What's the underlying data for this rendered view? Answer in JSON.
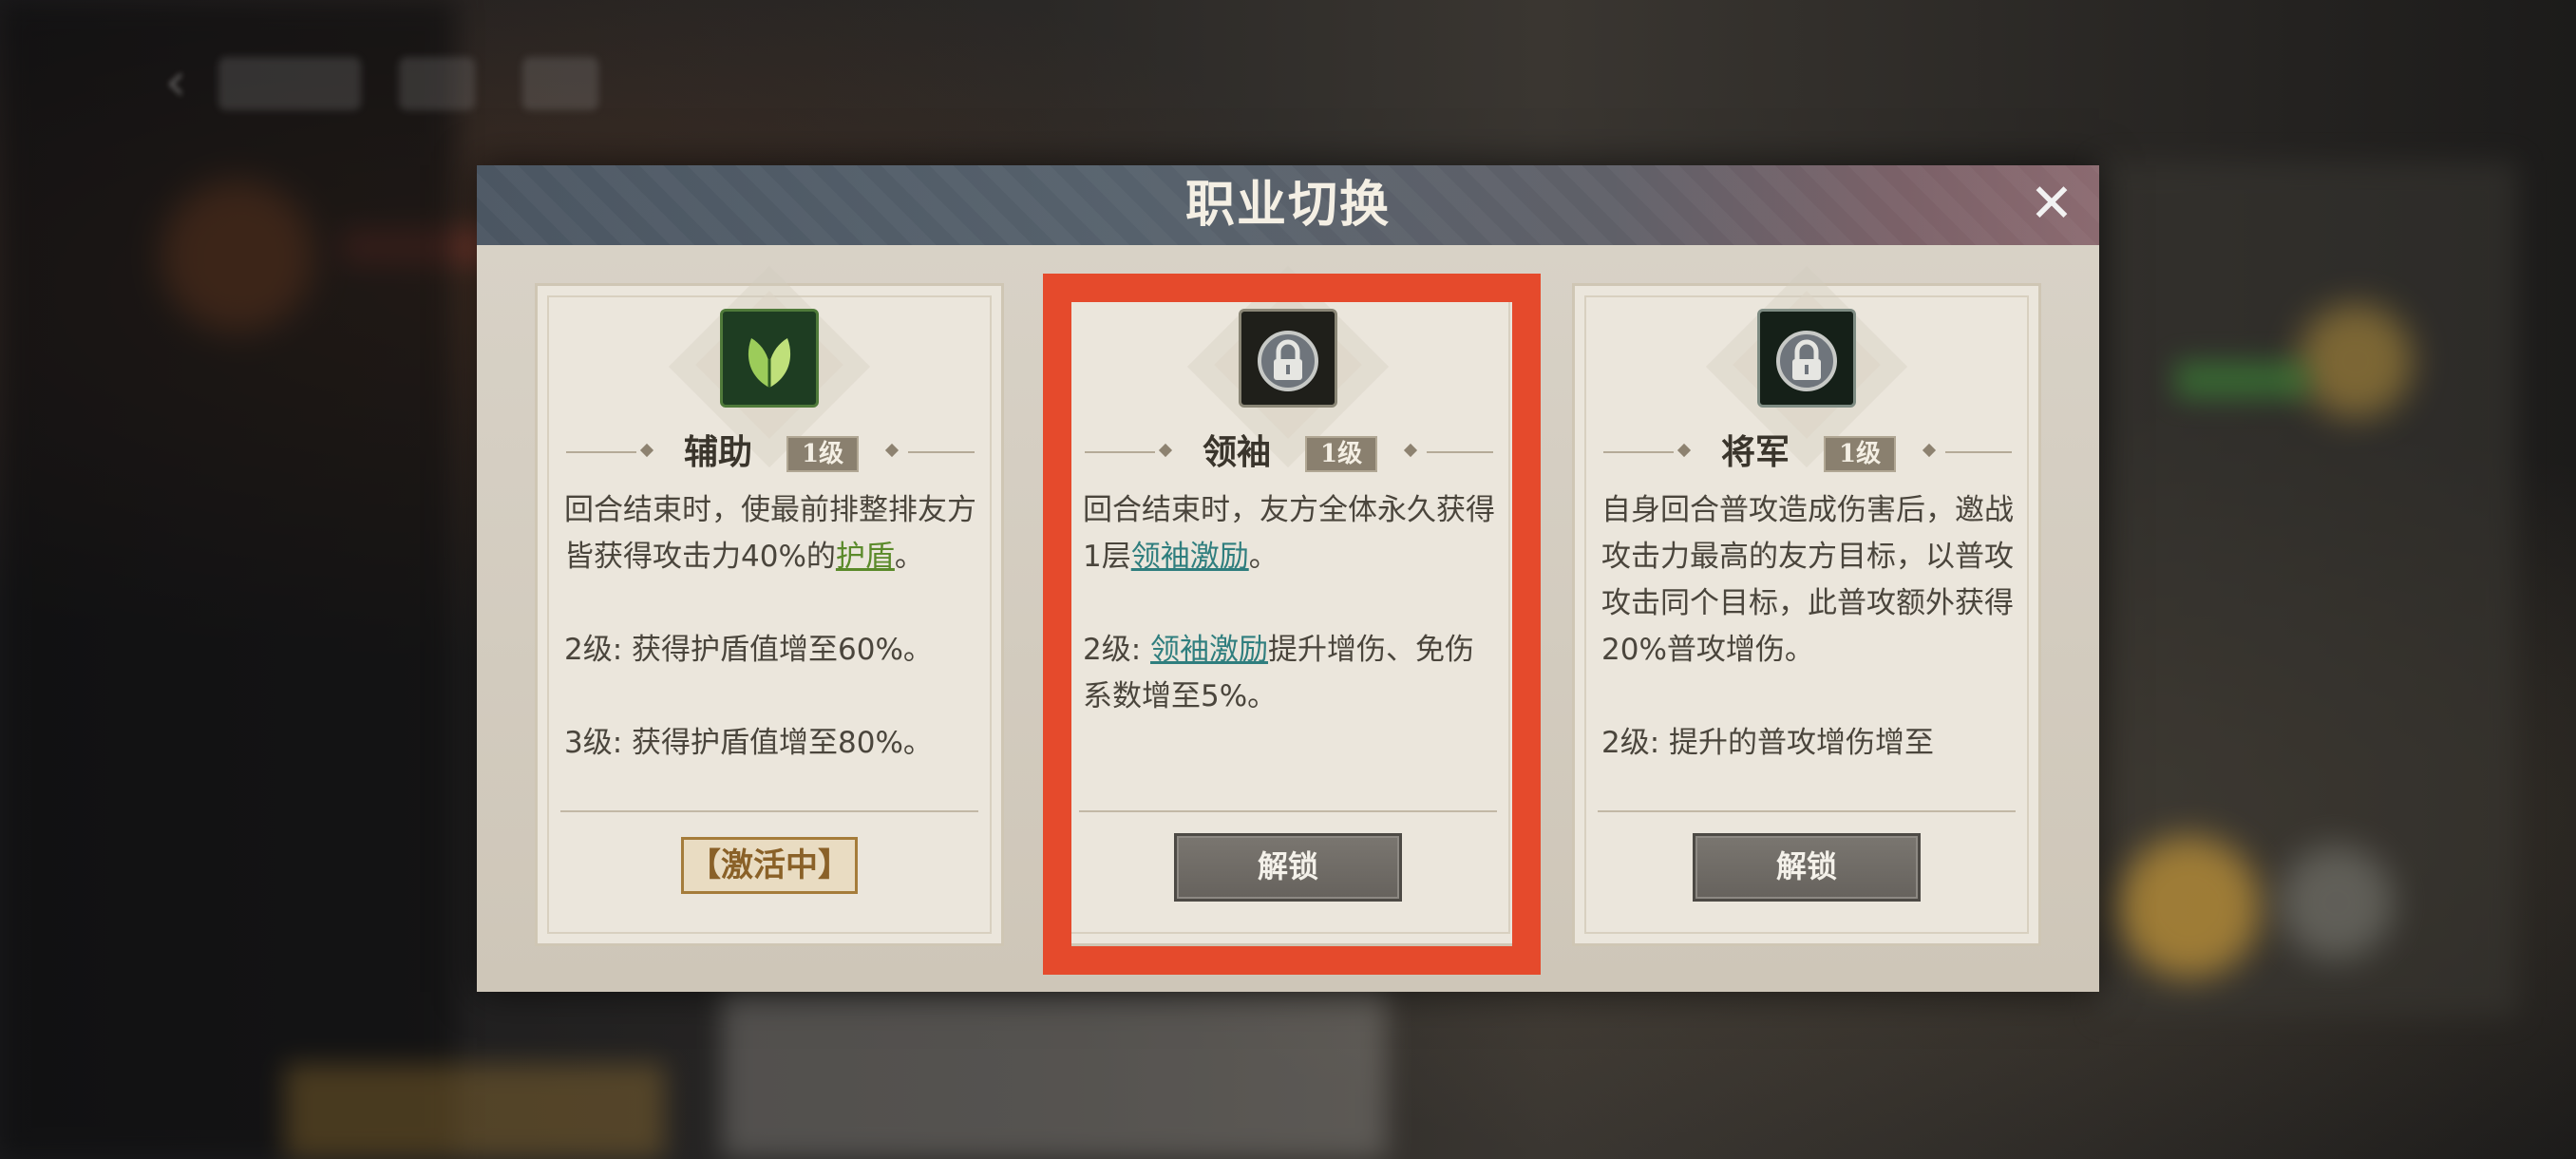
{
  "dialog": {
    "title": "职业切换",
    "close_symbol": "✕",
    "cards": [
      {
        "name": "辅助",
        "level": "1级",
        "icon": "leaf-icon",
        "desc1": "回合结束时，使最前排整排友方皆获得攻击力40%的",
        "keyword": "护盾",
        "desc1_end": "。",
        "line2": "2级: 获得护盾值增至60%。",
        "line3": "3级: 获得护盾值增至80%。",
        "status": "【激活中】"
      },
      {
        "name": "领袖",
        "level": "1级",
        "icon": "lock-icon",
        "desc1": "回合结束时，友方全体永久获得1层",
        "keyword": "领袖激励",
        "desc1_end": "。",
        "line2_prefix": "2级: ",
        "line2_keyword": "领袖激励",
        "line2_rest": "提升增伤、免伤系数增至5%。",
        "button": "解锁"
      },
      {
        "name": "将军",
        "level": "1级",
        "icon": "lock-icon",
        "desc1": "自身回合普攻造成伤害后，邀战攻击力最高的友方目标，以普攻攻击同个目标，此普攻额外获得20%普攻增伤。",
        "line2": "2级: 提升的普攻增伤增至",
        "button": "解锁"
      }
    ]
  },
  "colors": {
    "highlight": "#e54a2c",
    "keyword_green": "#5a8a2a",
    "keyword_teal": "#2f7e7e",
    "header": "#56616c"
  }
}
